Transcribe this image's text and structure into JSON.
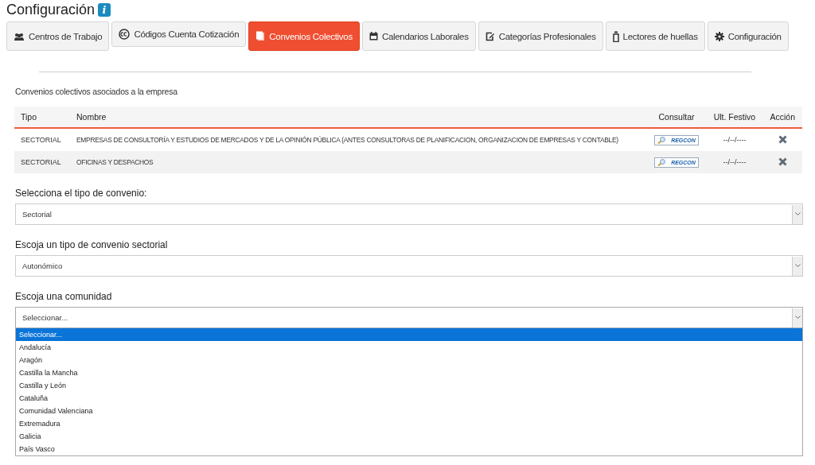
{
  "page": {
    "title": "Configuración",
    "info_badge": "i"
  },
  "tabs": [
    {
      "label": "Centros de Trabajo",
      "selected": false
    },
    {
      "label": "Códigos Cuenta Cotización",
      "selected": false
    },
    {
      "label": "Convenios Colectivos",
      "selected": true
    },
    {
      "label": "Calendarios Laborales",
      "selected": false
    },
    {
      "label": "Categorías Profesionales",
      "selected": false
    },
    {
      "label": "Lectores de huellas",
      "selected": false
    },
    {
      "label": "Configuración",
      "selected": false
    }
  ],
  "section_title": "Convenios colectivos asociados a la empresa",
  "table": {
    "columns": [
      "Tipo",
      "Nombre",
      "Consultar",
      "Ult. Festivo",
      "Acción"
    ],
    "rows": [
      {
        "tipo": "SECTORIAL",
        "nombre": "EMPRESAS DE CONSULTORÍA Y ESTUDIOS DE MERCADOS Y DE LA OPINIÓN PÚBLICA (ANTES CONSULTORAS DE PLANIFICACION, ORGANIZACION DE EMPRESAS Y CONTABLE)",
        "consultar": "REGCON",
        "festivo": "--/--/----"
      },
      {
        "tipo": "SECTORIAL",
        "nombre": "OFICINAS Y DESPACHOS",
        "consultar": "REGCON",
        "festivo": "--/--/----"
      }
    ]
  },
  "selects": [
    {
      "label": "Selecciona el tipo de convenio:",
      "value": "Sectorial",
      "expanded": false
    },
    {
      "label": "Escoja un tipo de convenio sectorial",
      "value": "Autonómico",
      "expanded": false
    },
    {
      "label": "Escoja una comunidad",
      "value": "Seleccionar...",
      "expanded": true,
      "options": [
        {
          "label": "Seleccionar...",
          "selected": true
        },
        {
          "label": "Andalucía",
          "selected": false
        },
        {
          "label": "Aragón",
          "selected": false
        },
        {
          "label": "Castilla la Mancha",
          "selected": false
        },
        {
          "label": "Castilla y León",
          "selected": false
        },
        {
          "label": "Cataluña",
          "selected": false
        },
        {
          "label": "Comunidad Valenciana",
          "selected": false
        },
        {
          "label": "Extremadura",
          "selected": false
        },
        {
          "label": "Galicia",
          "selected": false
        },
        {
          "label": "País Vasco",
          "selected": false
        }
      ]
    }
  ]
}
